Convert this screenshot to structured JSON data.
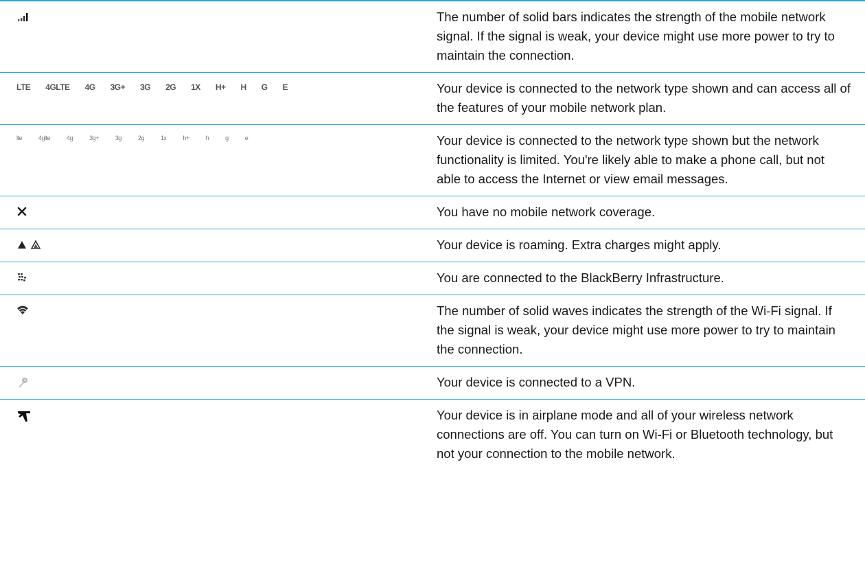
{
  "rows": [
    {
      "icon": "signal-bars-icon",
      "description": "The number of solid bars indicates the strength of the mobile network signal. If the signal is weak, your device might use more power to try to maintain the connection."
    },
    {
      "icon": "network-type-icons",
      "glyphs": [
        "LTE",
        "4GLTE",
        "4G",
        "3G+",
        "3G",
        "2G",
        "1X",
        "H+",
        "H",
        "G",
        "E"
      ],
      "description": "Your device is connected to the network type shown and can access all of the features of your mobile network plan."
    },
    {
      "icon": "limited-network-type-icons",
      "glyphs": [
        "lte",
        "4glte",
        "4g",
        "3g+",
        "3g",
        "2g",
        "1x",
        "h+",
        "h",
        "g",
        "e"
      ],
      "description": "Your device is connected to the network type shown but the network functionality is limited. You're likely able to make a phone call, but not able to access the Internet or view email messages."
    },
    {
      "icon": "no-coverage-icon",
      "description": "You have no mobile network coverage."
    },
    {
      "icon": "roaming-icon",
      "description": "Your device is roaming. Extra charges might apply."
    },
    {
      "icon": "blackberry-infrastructure-icon",
      "description": "You are connected to the BlackBerry Infrastructure."
    },
    {
      "icon": "wifi-icon",
      "description": "The number of solid waves indicates the strength of the Wi-Fi signal. If the signal is weak, your device might use more power to try to maintain the connection."
    },
    {
      "icon": "vpn-key-icon",
      "description": "Your device is connected to a VPN."
    },
    {
      "icon": "airplane-icon",
      "description": "Your device is in airplane mode and all of your wireless network connections are off. You can turn on Wi-Fi or Bluetooth technology, but not your connection to the mobile network."
    }
  ]
}
